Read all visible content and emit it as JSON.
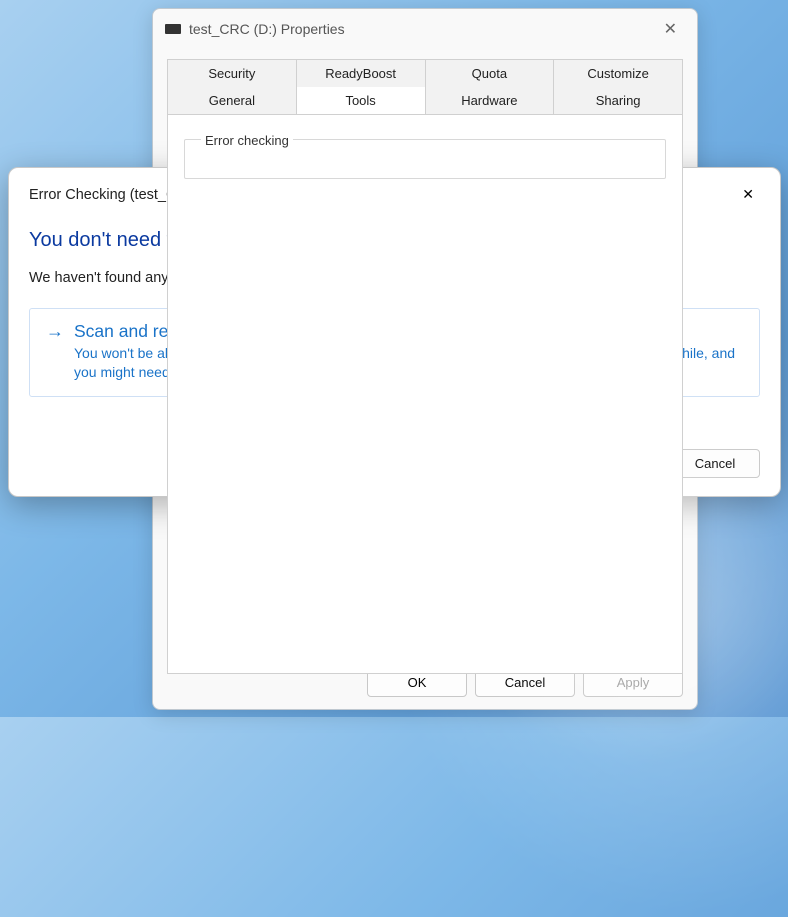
{
  "properties_window": {
    "title": "test_CRC (D:) Properties",
    "tabs_row1": [
      "Security",
      "ReadyBoost",
      "Quota",
      "Customize"
    ],
    "tabs_row2": [
      "General",
      "Tools",
      "Hardware",
      "Sharing"
    ],
    "active_tab": "Tools",
    "group_label": "Error checking",
    "buttons": {
      "ok": "OK",
      "cancel": "Cancel",
      "apply": "Apply"
    }
  },
  "error_dialog": {
    "title": "Error Checking (test_CRC (D:))",
    "headline": "You don't need to scan this drive",
    "body": "We haven't found any errors on this drive. You can still scan the drive for errors if you want.",
    "command": {
      "heading": "Scan and repair drive",
      "desc": "You won't be able to use the drive while Windows finds and repairs any errors. This might take a while, and you might need to restart your computer."
    },
    "cancel": "Cancel"
  }
}
